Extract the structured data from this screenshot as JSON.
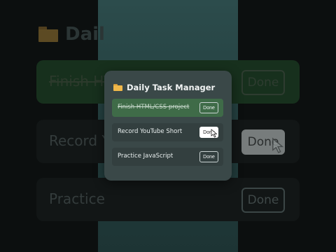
{
  "app": {
    "title": "Daily Task Manager",
    "title_icon": "folder-icon"
  },
  "background": {
    "title": "Dail",
    "rows": [
      {
        "text": "Finish HT",
        "button": "Done"
      },
      {
        "text": "Record Y",
        "button": "Done"
      },
      {
        "text": "Practice",
        "button": "Done"
      }
    ]
  },
  "tasks": [
    {
      "label": "Finish HTML/CSS project",
      "done": true,
      "button": "Done"
    },
    {
      "label": "Record YouTube Short",
      "done": false,
      "button": "Done"
    },
    {
      "label": "Practice JavaScript",
      "done": false,
      "button": "Done"
    }
  ],
  "colors": {
    "card": "#3a4848",
    "done_row": "#3f6b48",
    "accent_folder": "#f0b84a"
  }
}
